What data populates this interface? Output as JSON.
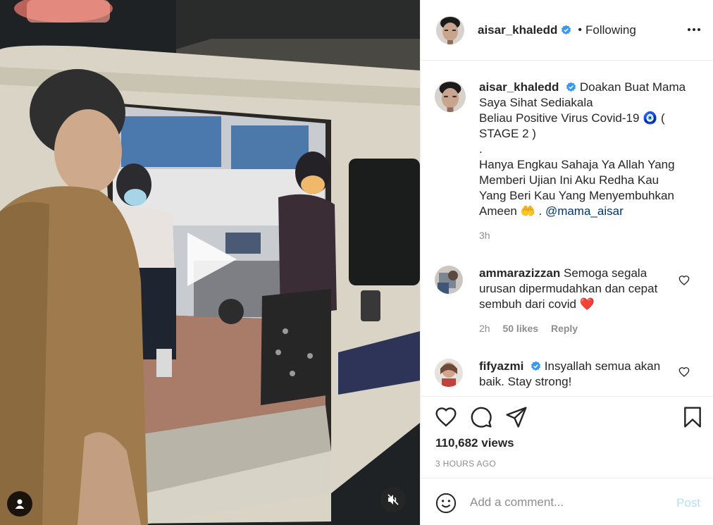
{
  "post": {
    "author": "aisar_khaledd",
    "follow_dot": "•",
    "follow_status": "Following",
    "verified": true
  },
  "caption": {
    "username": "aisar_khaledd",
    "lines": [
      "Doakan Buat Mama",
      "Saya Sihat Sediakala",
      "Beliau Positive Virus Covid-19 🧿 (",
      "STAGE 2 )",
      ".",
      "Hanya Engkau Sahaja Ya Allah Yang",
      "Memberi Ujian Ini Aku Redha Kau",
      "Yang Beri Kau Yang Menyembuhkan",
      "Ameen 🤲 ."
    ],
    "mention": "@mama_aisar",
    "time": "3h"
  },
  "comments": [
    {
      "username": "ammarazizzan",
      "text": "Semoga segala urusan dipermudahkan dan cepat sembuh dari covid ❤️",
      "time": "2h",
      "likes": "50 likes",
      "reply": "Reply"
    },
    {
      "username": "fifyazmi",
      "verified": true,
      "text": "Insyallah semua akan baik. Stay strong!"
    }
  ],
  "stats": {
    "views": "110,682 views",
    "posted": "3 HOURS AGO"
  },
  "composer": {
    "placeholder": "Add a comment...",
    "post_label": "Post"
  },
  "icons": {
    "more": "more-horizontal-icon",
    "like": "heart-outline-icon",
    "comment": "comment-bubble-icon",
    "share": "paper-plane-icon",
    "save": "bookmark-icon",
    "emoji": "smiley-icon",
    "play": "play-icon",
    "mute": "volume-muted-icon",
    "tags": "user-tag-icon"
  },
  "colors": {
    "verified_badge": "#3897f0",
    "post_disabled": "#b2dffc",
    "secondary_text": "#8e8e8e",
    "mention_link": "#00376b"
  }
}
